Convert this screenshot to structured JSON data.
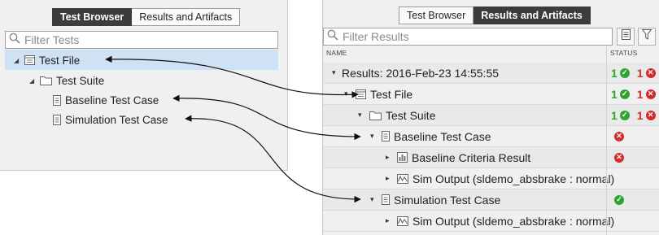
{
  "left": {
    "tabs": [
      "Test Browser",
      "Results and Artifacts"
    ],
    "active_tab": 0,
    "filter_placeholder": "Filter Tests",
    "tree": [
      {
        "label": "Test File",
        "icon": "test-file-icon"
      },
      {
        "label": "Test Suite",
        "icon": "folder-icon"
      },
      {
        "label": "Baseline Test Case",
        "icon": "document-icon"
      },
      {
        "label": "Simulation Test Case",
        "icon": "document-icon"
      }
    ]
  },
  "right": {
    "tabs": [
      "Test Browser",
      "Results and Artifacts"
    ],
    "active_tab": 1,
    "filter_placeholder": "Filter Results",
    "columns": {
      "name": "NAME",
      "status": "STATUS"
    },
    "rows": [
      {
        "label": "Results: 2016-Feb-23 14:55:55",
        "pass": "1",
        "fail": "1"
      },
      {
        "label": "Test File",
        "pass": "1",
        "fail": "1"
      },
      {
        "label": "Test Suite",
        "pass": "1",
        "fail": "1"
      },
      {
        "label": "Baseline Test Case",
        "status": "fail"
      },
      {
        "label": "Baseline Criteria Result",
        "status": "fail"
      },
      {
        "label": "Sim Output (sldemo_absbrake : normal)"
      },
      {
        "label": "Simulation Test Case",
        "status": "pass"
      },
      {
        "label": "Sim Output (sldemo_absbrake : normal)"
      }
    ]
  },
  "colors": {
    "pass": "#2fa52f",
    "fail": "#d52b2b",
    "selection": "#cfe2f3",
    "active_tab": "#3c3c3c"
  }
}
